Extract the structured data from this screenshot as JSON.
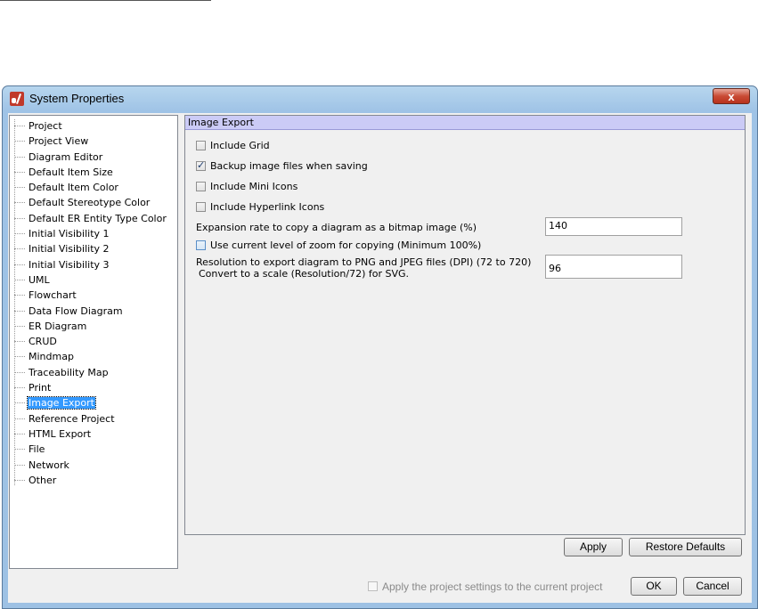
{
  "window": {
    "title": "System Properties",
    "close_label": "x"
  },
  "tree": {
    "items": [
      "Project",
      "Project View",
      "Diagram Editor",
      "Default Item Size",
      "Default Item Color",
      "Default Stereotype Color",
      "Default ER Entity Type Color",
      "Initial Visibility 1",
      "Initial Visibility 2",
      "Initial Visibility 3",
      "UML",
      "Flowchart",
      "Data Flow Diagram",
      "ER Diagram",
      "CRUD",
      "Mindmap",
      "Traceability Map",
      "Print",
      "Image Export",
      "Reference Project",
      "HTML Export",
      "File",
      "Network",
      "Other"
    ],
    "selected": "Image Export"
  },
  "panel": {
    "header": "Image Export",
    "include_grid": {
      "label": "Include Grid",
      "checked": false
    },
    "backup_images": {
      "label": "Backup image files when saving",
      "checked": true
    },
    "include_mini_icons": {
      "label": "Include Mini Icons",
      "checked": false
    },
    "include_hyperlink_icons": {
      "label": "Include Hyperlink Icons",
      "checked": false
    },
    "expansion_rate": {
      "label": "Expansion rate to copy a diagram as a bitmap image (%)",
      "value": "140"
    },
    "use_zoom": {
      "label": "Use current level of zoom for copying (Minimum 100%)",
      "checked": false
    },
    "resolution": {
      "label_line1": "Resolution to export diagram to PNG and JPEG files (DPI) (72 to 720)",
      "label_line2": "Convert to a scale (Resolution/72) for SVG.",
      "value": "96"
    },
    "apply_label": "Apply",
    "restore_label": "Restore Defaults"
  },
  "footer": {
    "apply_project_label": "Apply the project settings to the current project",
    "ok_label": "OK",
    "cancel_label": "Cancel"
  }
}
